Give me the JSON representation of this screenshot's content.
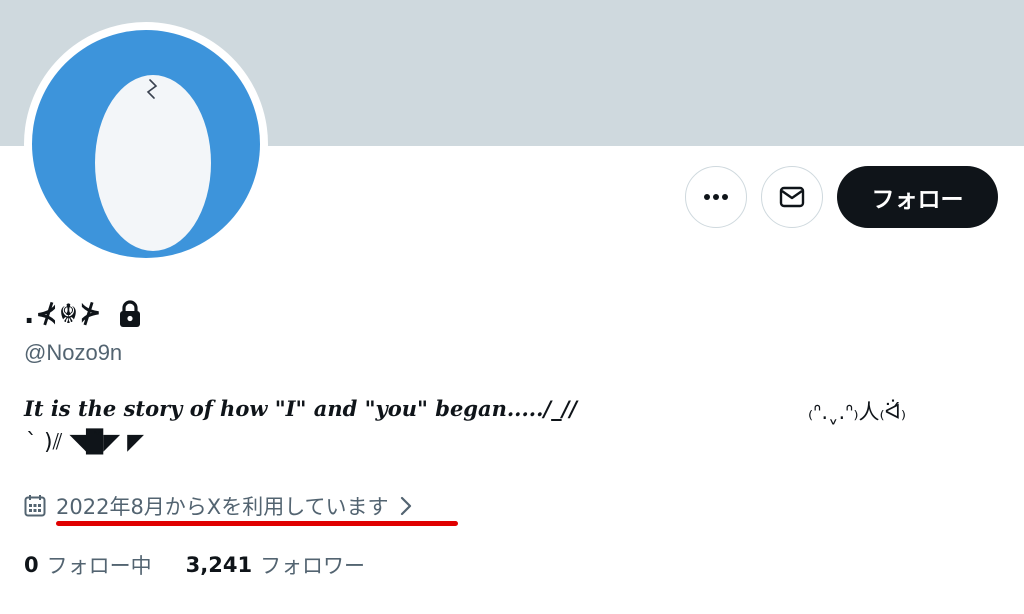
{
  "profile": {
    "display_name": ".⊀☬⊁",
    "handle": "@Nozo9n",
    "bio_line1": "It is the story of how \"I\" and \"you\" began...../_//",
    "bio_kaomoji": "₍ᐢ.ˬ.ᐢ₎人₍ᐛ́₎",
    "bio_line2": "` )⫽ ◥█̆̈◤ ◤",
    "joined_text": "2022年8月からXを利用しています"
  },
  "actions": {
    "follow_label": "フォロー"
  },
  "stats": {
    "following_count": "0",
    "following_label": "フォロー中",
    "followers_count": "3,241",
    "followers_label": "フォロワー"
  },
  "colors": {
    "banner": "#cfd9de",
    "avatar_bg": "#3d94db",
    "text_primary": "#0f1419",
    "text_secondary": "#536471",
    "highlight_underline": "#e00000"
  },
  "icons": [
    "more-icon",
    "mail-icon",
    "lock-icon",
    "calendar-icon",
    "chevron-right-icon",
    "egg-avatar-icon"
  ]
}
